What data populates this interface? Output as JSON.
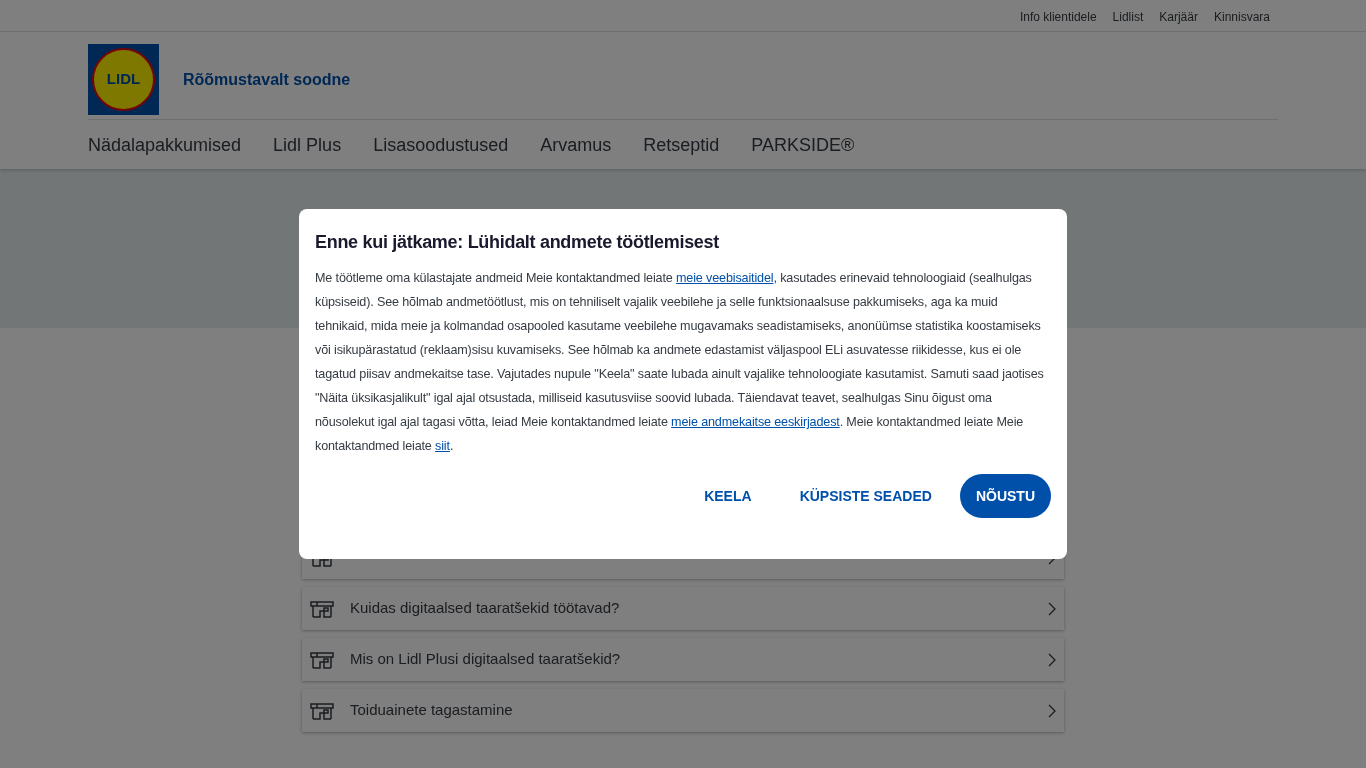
{
  "top_links": [
    "Info klientidele",
    "Lidlist",
    "Karjäär",
    "Kinnisvara"
  ],
  "header": {
    "logo_text": "LIDL",
    "slogan": "Rõõmustavalt soodne"
  },
  "nav": [
    "Nädalapakkumised",
    "Lidl Plus",
    "Lisasoodustused",
    "Arvamus",
    "Retseptid",
    "PARKSIDE®"
  ],
  "faq": [
    {
      "kind": "covered"
    },
    {
      "kind": "question",
      "title": "Kuidas digitaalsed taaratšekid töötavad?"
    },
    {
      "kind": "question",
      "title": "Mis on Lidl Plusi digitaalsed taaratšekid?"
    },
    {
      "kind": "question",
      "title": "Toiduainete tagastamine"
    }
  ],
  "dialog": {
    "title": "Enne kui jätkame: Lühidalt andmete töötlemisest",
    "body": [
      {
        "kind": "text",
        "text": "Me töötleme oma külastajate andmeid Meie kontaktandmed leiate "
      },
      {
        "kind": "link",
        "text": "meie veebisaitidel"
      },
      {
        "kind": "text",
        "text": ", kasutades erinevaid tehnoloogiaid (sealhulgas küpsiseid). See hõlmab andmetöötlust, mis on tehniliselt vajalik veebilehe ja selle funktsionaalsuse pakkumiseks, aga ka muid tehnikaid, mida meie ja kolmandad osapooled kasutame veebilehe mugavamaks seadistamiseks, anonüümse statistika koostamiseks või isikupärastatud (reklaam)sisu kuvamiseks. See hõlmab ka andmete edastamist väljaspool ELi asuvatesse riikidesse, kus ei ole tagatud piisav andmekaitse tase. Vajutades nupule \"Keela\" saate lubada ainult vajalike tehnoloogiate kasutamist. Samuti saad jaotises \"Näita üksikasjalikult\" igal ajal otsustada, milliseid kasutusviise soovid lubada. Täiendavat teavet, sealhulgas Sinu õigust oma nõusolekut igal ajal tagasi võtta, leiad Meie kontaktandmed leiate "
      },
      {
        "kind": "link",
        "text": "meie andmekaitse eeskirjadest"
      },
      {
        "kind": "text",
        "text": ". Meie kontaktandmed leiate Meie kontaktandmed leiate "
      },
      {
        "kind": "link",
        "text": "siit"
      },
      {
        "kind": "text",
        "text": "."
      }
    ],
    "buttons": [
      {
        "label": "KEELA",
        "kind": "text"
      },
      {
        "label": "KÜPSISTE SEADED",
        "kind": "text"
      },
      {
        "label": "NÕUSTU",
        "kind": "primary"
      }
    ]
  }
}
